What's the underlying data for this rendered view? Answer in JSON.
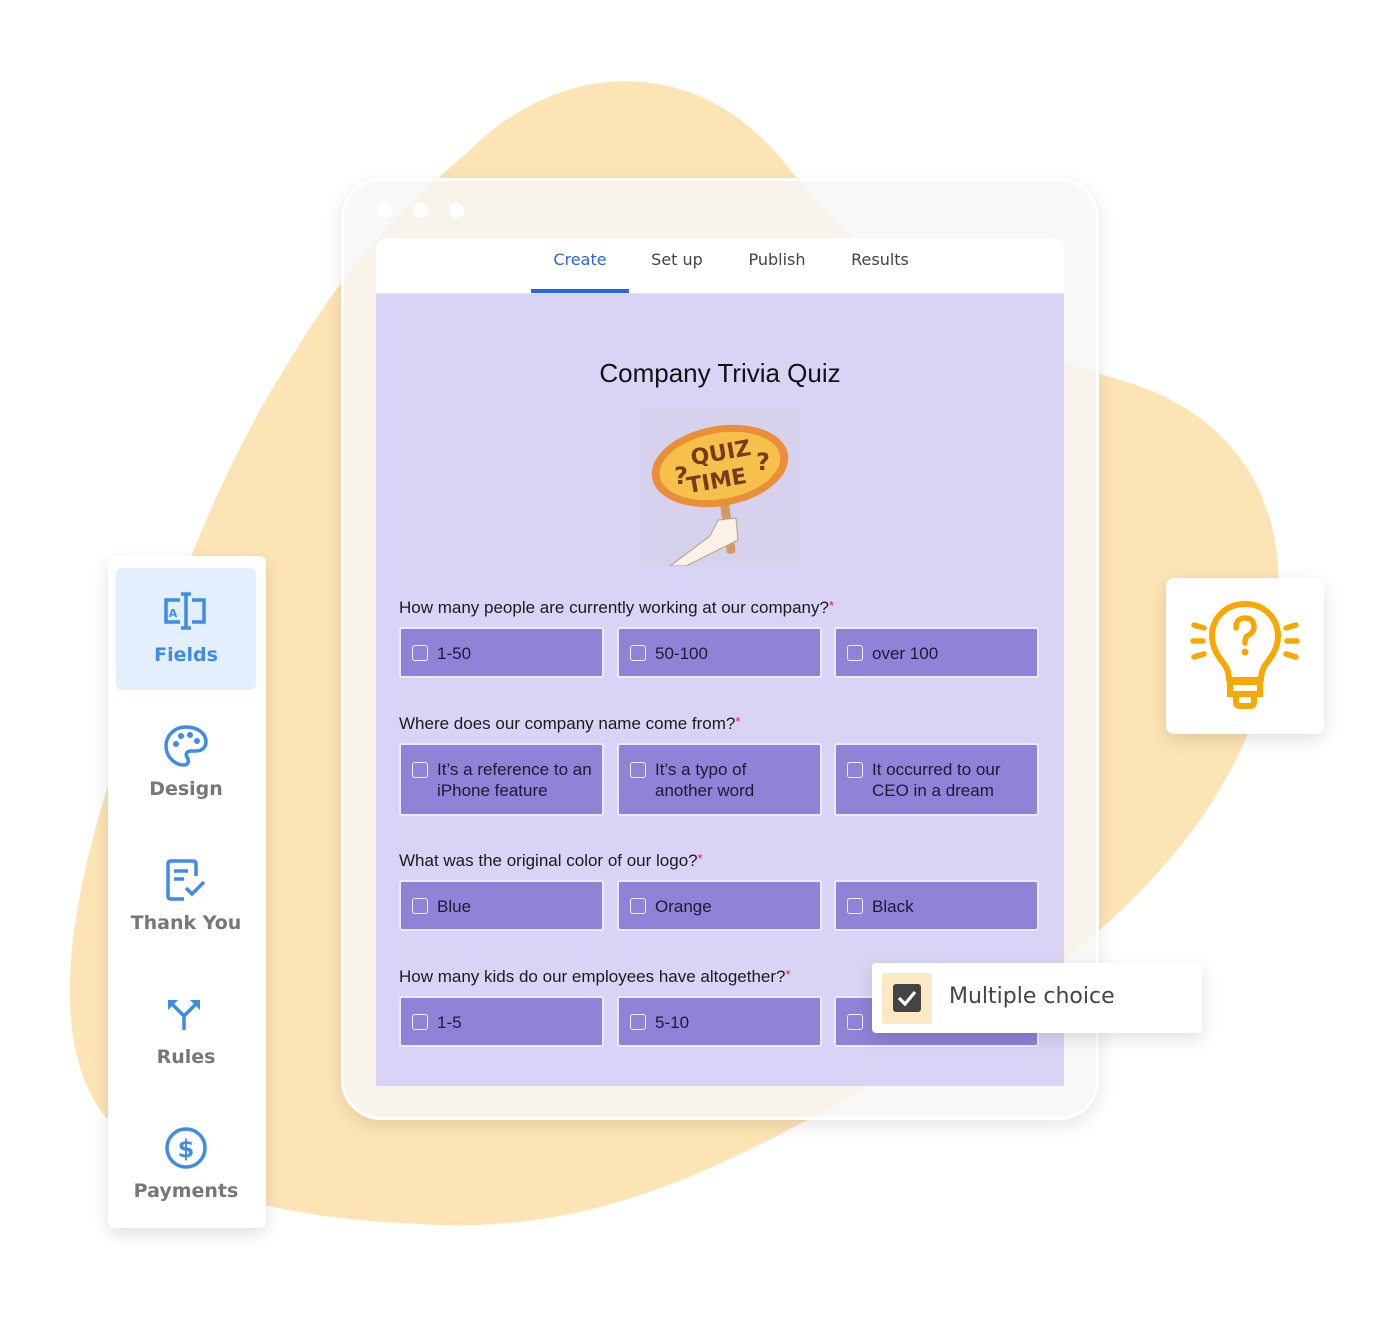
{
  "colors": {
    "accent_blue": "#2766e8",
    "blob": "#fde4b4",
    "form_background": "#d9d4f6",
    "option_fill": "#8e83d7",
    "required": "#e0242c",
    "bulb": "#f8a800"
  },
  "window": {
    "controls": [
      "window-dot",
      "window-dot",
      "window-dot"
    ]
  },
  "tabs": [
    {
      "label": "Create",
      "active": true
    },
    {
      "label": "Set up",
      "active": false
    },
    {
      "label": "Publish",
      "active": false
    },
    {
      "label": "Results",
      "active": false
    }
  ],
  "form": {
    "title": "Company Trivia Quiz",
    "image": {
      "sign_line1": "QUIZ",
      "sign_line2": "TIME",
      "mark": "?"
    },
    "questions": [
      {
        "text": "How many people are currently working at our company?",
        "required_mark": "*",
        "options": [
          "1-50",
          "50-100",
          "over 100"
        ]
      },
      {
        "text": "Where does our company name come from?",
        "required_mark": "*",
        "options": [
          "It’s a reference to an iPhone feature",
          "It’s a typo of another word",
          "It occurred to our CEO in a dream"
        ]
      },
      {
        "text": "What was the original color of our logo?",
        "required_mark": "*",
        "options": [
          "Blue",
          "Orange",
          "Black"
        ]
      },
      {
        "text": "How many kids do our employees have altogether?",
        "required_mark": "*",
        "options": [
          "1-5",
          "5-10",
          ""
        ]
      }
    ]
  },
  "sidebar": {
    "items": [
      {
        "label": "Fields",
        "icon": "text-field-icon",
        "active": true
      },
      {
        "label": "Design",
        "icon": "palette-icon",
        "active": false
      },
      {
        "label": "Thank You",
        "icon": "document-check-icon",
        "active": false
      },
      {
        "label": "Rules",
        "icon": "branch-arrows-icon",
        "active": false
      },
      {
        "label": "Payments",
        "icon": "dollar-circle-icon",
        "active": false
      }
    ]
  },
  "bulb_card": {
    "icon": "lightbulb-question-icon"
  },
  "multiple_choice_card": {
    "label": "Multiple choice",
    "icon": "checkbox-checked-icon"
  }
}
